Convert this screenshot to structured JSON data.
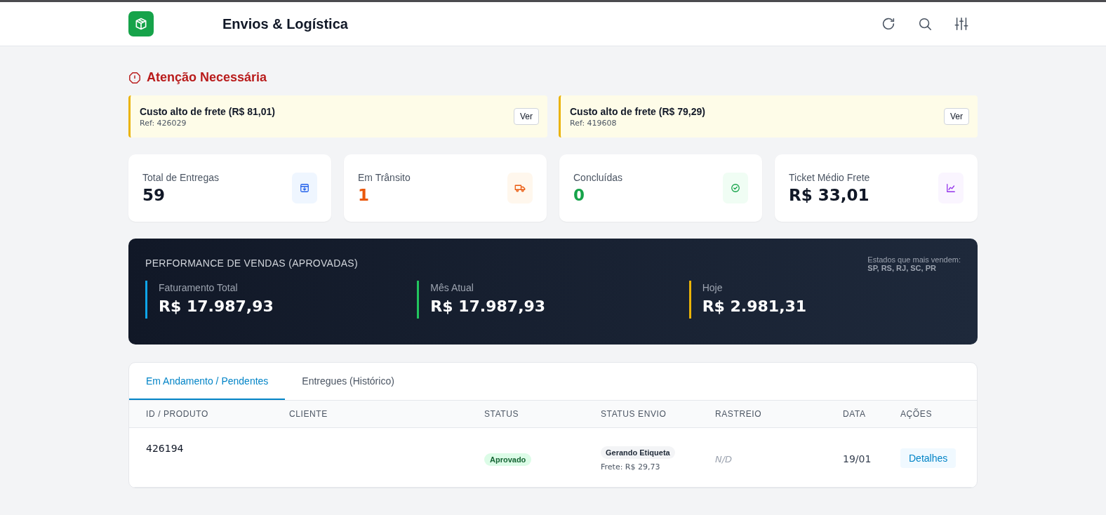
{
  "header": {
    "title": "Envios & Logística",
    "actions": [
      {
        "kind": "refresh"
      },
      {
        "kind": "search"
      },
      {
        "kind": "filters"
      }
    ]
  },
  "attention": {
    "title": "Atenção Necessária",
    "alerts": [
      {
        "title": "Custo alto de frete (R$ 81,01)",
        "ref": "Ref: 426029",
        "button": "Ver"
      },
      {
        "title": "Custo alto de frete (R$ 79,29)",
        "ref": "Ref: 419608",
        "button": "Ver"
      }
    ]
  },
  "stats": [
    {
      "label": "Total de Entregas",
      "value": "59",
      "kind": "total",
      "color": "#111827"
    },
    {
      "label": "Em Trânsito",
      "value": "1",
      "kind": "transit",
      "color": "#ea580c"
    },
    {
      "label": "Concluídas",
      "value": "0",
      "kind": "done",
      "color": "#16a34a"
    },
    {
      "label": "Ticket Médio Frete",
      "value": "R$ 33,01",
      "kind": "ticket",
      "color": "#111827"
    }
  ],
  "performance": {
    "title": "PERFORMANCE DE VENDAS (APROVADAS)",
    "top_states_label": "Estados que mais vendem:",
    "top_states": "SP, RS, RJ, SC, PR",
    "metrics": [
      {
        "label": "Faturamento Total",
        "value": "R$ 17.987,93",
        "color": "#0ea5e9"
      },
      {
        "label": "Mês Atual",
        "value": "R$ 17.987,93",
        "color": "#22c55e"
      },
      {
        "label": "Hoje",
        "value": "R$ 2.981,31",
        "color": "#eab308"
      }
    ]
  },
  "tabs": [
    {
      "label": "Em Andamento / Pendentes",
      "selected": true
    },
    {
      "label": "Entregues (Histórico)",
      "selected": false
    }
  ],
  "table": {
    "columns": [
      "ID / PRODUTO",
      "CLIENTE",
      "STATUS",
      "STATUS ENVIO",
      "RASTREIO",
      "DATA",
      "AÇÕES"
    ],
    "rows": [
      {
        "id": "426194",
        "status": "Aprovado",
        "shipping_status": "Gerando Etiqueta",
        "freight": "Frete: R$ 29,73",
        "tracking": "N/D",
        "date": "19/01",
        "action": "Detalhes"
      }
    ]
  }
}
